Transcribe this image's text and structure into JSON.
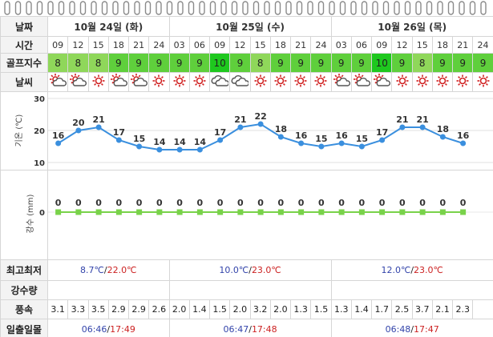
{
  "labels": {
    "date": "날짜",
    "time": "시간",
    "golf": "골프지수",
    "sky": "날씨",
    "temp": "기온 (℃)",
    "rain": "강수 (mm)",
    "minmax": "최고최저",
    "precip": "강수량",
    "wind": "풍속",
    "sun": "일출일몰"
  },
  "days": [
    {
      "label": "10월 24일 (화)",
      "span": 6,
      "low": "8.7℃",
      "sep": "/",
      "high": "22.0℃",
      "sunrise": "06:46",
      "sunset": "17:49"
    },
    {
      "label": "10월 25일 (수)",
      "span": 8,
      "low": "10.0℃",
      "sep": "/",
      "high": "23.0℃",
      "sunrise": "06:47",
      "sunset": "17:48"
    },
    {
      "label": "10월 26일 (목)",
      "span": 8,
      "low": "12.0℃",
      "sep": "/",
      "high": "23.0℃",
      "sunrise": "06:48",
      "sunset": "17:47"
    }
  ],
  "hours": [
    "09",
    "12",
    "15",
    "18",
    "21",
    "24",
    "03",
    "06",
    "09",
    "12",
    "15",
    "18",
    "21",
    "24",
    "03",
    "06",
    "09",
    "12",
    "15",
    "18",
    "21",
    "24"
  ],
  "golf": [
    "8",
    "8",
    "8",
    "9",
    "9",
    "9",
    "9",
    "9",
    "10",
    "9",
    "8",
    "9",
    "9",
    "9",
    "9",
    "9",
    "10",
    "9",
    "8",
    "9",
    "9",
    "9"
  ],
  "sky": [
    "partly-cloudy-icon",
    "partly-cloudy-icon",
    "sunny-icon",
    "partly-cloudy-icon",
    "partly-cloudy-icon",
    "sunny-icon",
    "sunny-icon",
    "sunny-icon",
    "cloudy-icon",
    "cloudy-icon",
    "sunny-icon",
    "sunny-icon",
    "sunny-icon",
    "sunny-icon",
    "partly-cloudy-icon",
    "partly-cloudy-icon",
    "partly-cloudy-icon",
    "sunny-icon",
    "sunny-icon",
    "sunny-icon",
    "sunny-icon",
    "sunny-icon"
  ],
  "wind": [
    "3.1",
    "3.3",
    "3.5",
    "2.9",
    "2.9",
    "2.6",
    "2.0",
    "1.4",
    "1.5",
    "2.0",
    "3.2",
    "2.0",
    "1.3",
    "1.5",
    "1.3",
    "1.4",
    "1.7",
    "2.5",
    "3.7",
    "2.1",
    "2.3"
  ],
  "colors": {
    "golf8": "#8fd75a",
    "golf9": "#5fcf3c",
    "golf10": "#1ec81e",
    "temp_line": "#3a8fde",
    "rain_line": "#79d24a",
    "low": "#3344aa",
    "high": "#cc2222"
  },
  "chart_data": [
    {
      "type": "line",
      "ylabel": "기온 (℃)",
      "x": [
        "09",
        "12",
        "15",
        "18",
        "21",
        "24",
        "03",
        "06",
        "09",
        "12",
        "15",
        "18",
        "21",
        "24",
        "03",
        "06",
        "09",
        "12",
        "15",
        "18",
        "21",
        "24"
      ],
      "series": [
        {
          "values": [
            16,
            20,
            21,
            17,
            15,
            14,
            14,
            14,
            17,
            21,
            22,
            18,
            16,
            15,
            16,
            15,
            17,
            21,
            21,
            18,
            16
          ]
        }
      ],
      "yticks": [
        10,
        20,
        30
      ],
      "ylim": [
        10,
        30
      ],
      "grid": true
    },
    {
      "type": "line",
      "ylabel": "강수 (mm)",
      "x": [
        "09",
        "12",
        "15",
        "18",
        "21",
        "24",
        "03",
        "06",
        "09",
        "12",
        "15",
        "18",
        "21",
        "24",
        "03",
        "06",
        "09",
        "12",
        "15",
        "18",
        "21",
        "24"
      ],
      "series": [
        {
          "values": [
            0,
            0,
            0,
            0,
            0,
            0,
            0,
            0,
            0,
            0,
            0,
            0,
            0,
            0,
            0,
            0,
            0,
            0,
            0,
            0,
            0
          ]
        }
      ],
      "yticks": [
        0
      ],
      "grid": false
    }
  ]
}
